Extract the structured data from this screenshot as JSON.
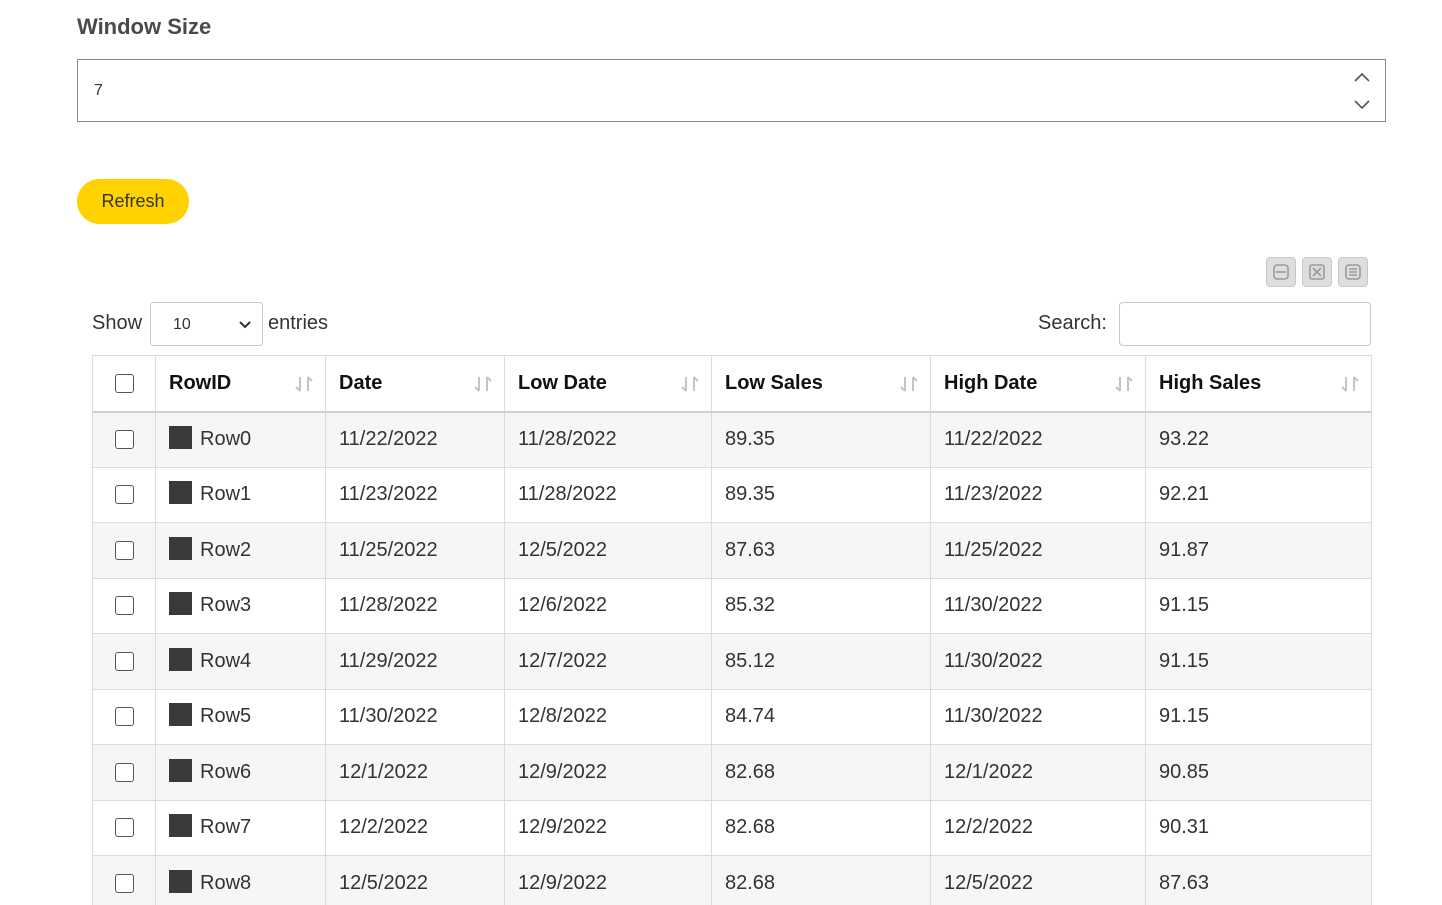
{
  "window_size": {
    "label": "Window Size",
    "value": "7"
  },
  "refresh_label": "Refresh",
  "toolbar": {
    "icons": [
      "collapse-icon",
      "fullscreen-icon",
      "menu-icon"
    ]
  },
  "table_controls": {
    "show_label": "Show",
    "entries_value": "10",
    "entries_label": "entries",
    "search_label": "Search:",
    "search_value": ""
  },
  "table": {
    "columns": [
      "RowID",
      "Date",
      "Low Date",
      "Low Sales",
      "High Date",
      "High Sales"
    ],
    "swatch_color": "#3a3a3a",
    "rows": [
      {
        "id": "Row0",
        "date": "11/22/2022",
        "low_date": "11/28/2022",
        "low_sales": "89.35",
        "high_date": "11/22/2022",
        "high_sales": "93.22"
      },
      {
        "id": "Row1",
        "date": "11/23/2022",
        "low_date": "11/28/2022",
        "low_sales": "89.35",
        "high_date": "11/23/2022",
        "high_sales": "92.21"
      },
      {
        "id": "Row2",
        "date": "11/25/2022",
        "low_date": "12/5/2022",
        "low_sales": "87.63",
        "high_date": "11/25/2022",
        "high_sales": "91.87"
      },
      {
        "id": "Row3",
        "date": "11/28/2022",
        "low_date": "12/6/2022",
        "low_sales": "85.32",
        "high_date": "11/30/2022",
        "high_sales": "91.15"
      },
      {
        "id": "Row4",
        "date": "11/29/2022",
        "low_date": "12/7/2022",
        "low_sales": "85.12",
        "high_date": "11/30/2022",
        "high_sales": "91.15"
      },
      {
        "id": "Row5",
        "date": "11/30/2022",
        "low_date": "12/8/2022",
        "low_sales": "84.74",
        "high_date": "11/30/2022",
        "high_sales": "91.15"
      },
      {
        "id": "Row6",
        "date": "12/1/2022",
        "low_date": "12/9/2022",
        "low_sales": "82.68",
        "high_date": "12/1/2022",
        "high_sales": "90.85"
      },
      {
        "id": "Row7",
        "date": "12/2/2022",
        "low_date": "12/9/2022",
        "low_sales": "82.68",
        "high_date": "12/2/2022",
        "high_sales": "90.31"
      },
      {
        "id": "Row8",
        "date": "12/5/2022",
        "low_date": "12/9/2022",
        "low_sales": "82.68",
        "high_date": "12/5/2022",
        "high_sales": "87.63"
      }
    ]
  }
}
